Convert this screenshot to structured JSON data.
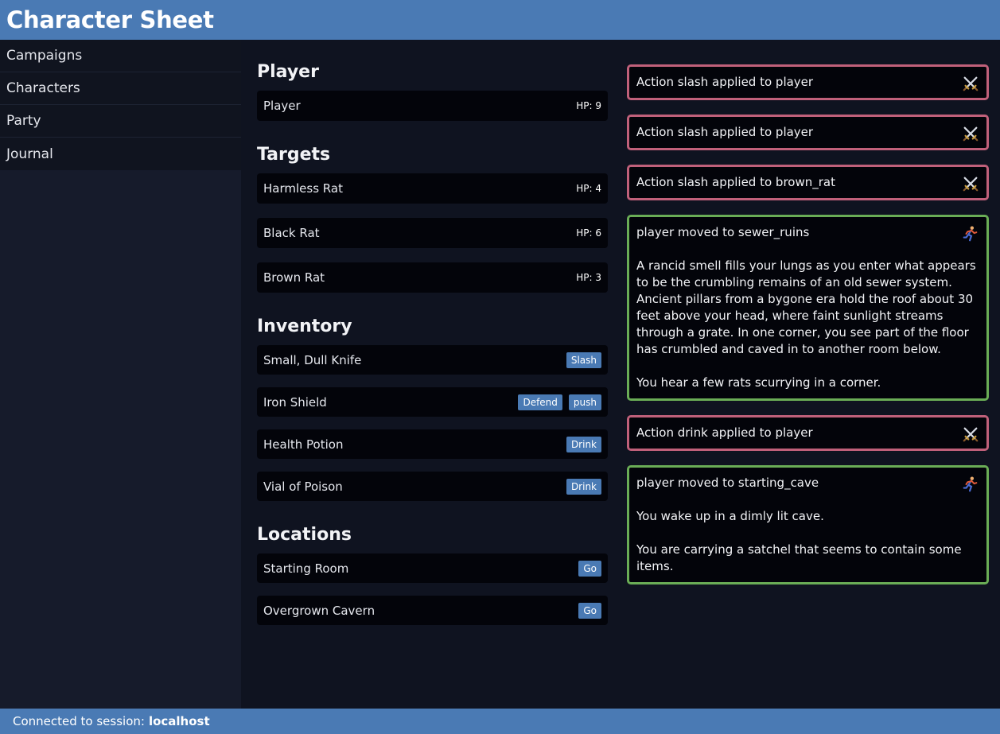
{
  "header": {
    "title": "Character Sheet"
  },
  "sidebar": {
    "items": [
      {
        "label": "Campaigns"
      },
      {
        "label": "Characters"
      },
      {
        "label": "Party"
      },
      {
        "label": "Journal"
      }
    ]
  },
  "main": {
    "player_heading": "Player",
    "player": {
      "name": "Player",
      "hp": "HP: 9"
    },
    "targets_heading": "Targets",
    "targets": [
      {
        "name": "Harmless Rat",
        "hp": "HP: 4"
      },
      {
        "name": "Black Rat",
        "hp": "HP: 6"
      },
      {
        "name": "Brown Rat",
        "hp": "HP: 3"
      }
    ],
    "inventory_heading": "Inventory",
    "inventory": [
      {
        "name": "Small, Dull Knife",
        "actions": [
          "Slash"
        ]
      },
      {
        "name": "Iron Shield",
        "actions": [
          "Defend",
          "push"
        ]
      },
      {
        "name": "Health Potion",
        "actions": [
          "Drink"
        ]
      },
      {
        "name": "Vial of Poison",
        "actions": [
          "Drink"
        ]
      }
    ],
    "locations_heading": "Locations",
    "locations": [
      {
        "name": "Starting Room",
        "action": "Go"
      },
      {
        "name": "Overgrown Cavern",
        "action": "Go"
      }
    ]
  },
  "log": {
    "entries": [
      {
        "type": "action",
        "icon": "crossed-swords-icon",
        "text": "Action slash applied to player"
      },
      {
        "type": "action",
        "icon": "crossed-swords-icon",
        "text": "Action slash applied to player"
      },
      {
        "type": "action",
        "icon": "crossed-swords-icon",
        "text": "Action slash applied to brown_rat"
      },
      {
        "type": "move",
        "icon": "running-person-icon",
        "text": "player moved to sewer_ruins",
        "body": "A rancid smell fills your lungs as you enter what appears to be the crumbling remains of an old sewer system. Ancient pillars from a bygone era hold the roof about 30 feet above your head, where faint sunlight streams through a grate. In one corner, you see part of the floor has crumbled and caved in to another room below.\n\nYou hear a few rats scurrying in a corner."
      },
      {
        "type": "action",
        "icon": "crossed-swords-icon",
        "text": "Action drink applied to player"
      },
      {
        "type": "move",
        "icon": "running-person-icon",
        "text": "player moved to starting_cave",
        "body": "You wake up in a dimly lit cave.\n\nYou are carrying a satchel that seems to contain some items."
      }
    ]
  },
  "footer": {
    "prefix": "Connected to session:",
    "session": "localhost"
  },
  "colors": {
    "accent": "#4a7ab4",
    "action_border": "#c0607a",
    "move_border": "#6aad56"
  }
}
